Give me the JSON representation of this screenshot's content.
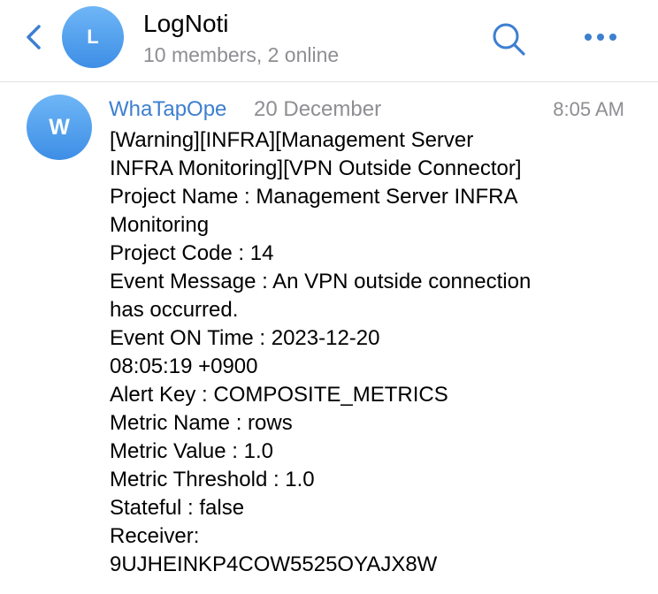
{
  "theme": {
    "accent": "#3d7fd0",
    "avatar_gradient_top": "#6fb6f6",
    "avatar_gradient_bottom": "#3d8ee6",
    "secondary_text": "#8e8e93"
  },
  "header": {
    "avatar_initial": "L",
    "title": "LogNoti",
    "subtitle": "10 members, 2 online",
    "icons": {
      "back": "chevron-left-icon",
      "search": "search-icon",
      "more": "more-horizontal-icon"
    }
  },
  "message": {
    "avatar_initial": "W",
    "sender": "WhaTapOpe",
    "date": "20 December",
    "time": "8:05 AM",
    "lines": [
      "[Warning][INFRA][Management Server",
      "INFRA Monitoring][VPN Outside Connector]",
      "Project Name : Management Server INFRA",
      "Monitoring",
      "Project Code : 14",
      "Event Message : An VPN outside connection",
      "has occurred.",
      "Event ON Time : 2023-12-20",
      "08:05:19 +0900",
      "Alert Key : COMPOSITE_METRICS",
      "Metric Name : rows",
      "Metric Value : 1.0",
      "Metric Threshold : 1.0",
      "Stateful : false",
      "Receiver:",
      "9UJHEINKP4COW5525OYAJX8W"
    ]
  }
}
